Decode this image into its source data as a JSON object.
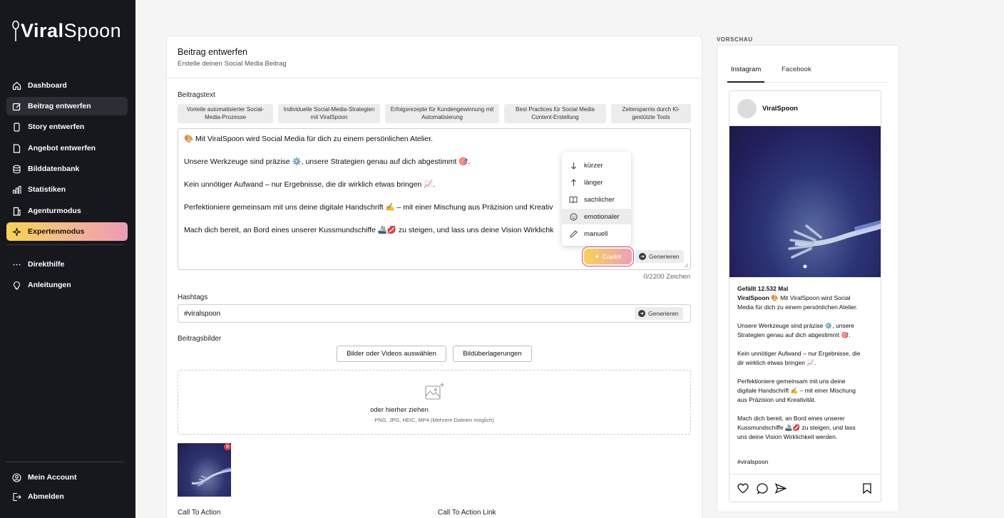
{
  "sidebar": {
    "logo_left": "Viral",
    "logo_right": "Spoon",
    "items": [
      {
        "label": "Dashboard",
        "icon": "home-icon"
      },
      {
        "label": "Beitrag entwerfen",
        "icon": "edit-icon"
      },
      {
        "label": "Story entwerfen",
        "icon": "phone-icon"
      },
      {
        "label": "Angebot entwerfen",
        "icon": "document-icon"
      },
      {
        "label": "Bilddatenbank",
        "icon": "database-icon"
      },
      {
        "label": "Statistiken",
        "icon": "bar-chart-icon"
      },
      {
        "label": "Agenturmodus",
        "icon": "building-icon"
      },
      {
        "label": "Expertenmodus",
        "icon": "sparkle-icon"
      }
    ],
    "secondary": [
      {
        "label": "Direkthilfe",
        "icon": "dots-icon"
      },
      {
        "label": "Anleitungen",
        "icon": "lightbulb-icon"
      }
    ],
    "account": [
      {
        "label": "Mein Account",
        "icon": "user-icon"
      },
      {
        "label": "Abmelden",
        "icon": "logout-icon"
      }
    ]
  },
  "editor": {
    "title": "Beitrag entwerfen",
    "subtitle": "Erstelle deinen Social Media Beitrag",
    "post_text_label": "Beitragstext",
    "suggestions": [
      "Vorteile automatisierter Social-Media-Prozesse",
      "Individuelle Social-Media-Strategien mit ViralSpoon",
      "Erfolgsrezepte für Kundengewinnung mit Automatisierung",
      "Best Practices für Social Media Content-Erstellung",
      "Zeitersparnis durch KI-gestützte Tools"
    ],
    "post_lines": [
      "🎨 Mit ViralSpoon wird Social Media für dich zu einem persönlichen Atelier.",
      "Unsere Werkzeuge sind präzise ⚙️, unsere Strategien genau auf dich abgestimmt 🎯.",
      "Kein unnötiger Aufwand – nur Ergebnisse, die dir wirklich etwas bringen 📈.",
      "Perfektioniere gemeinsam mit uns deine digitale Handschrift ✍️ – mit einer Mischung aus Präzision und Kreativ",
      "Mach dich bereit, an Bord eines unserer Kussmundschiffe 🚢💋 zu steigen, und lass uns deine Vision Wirklichk"
    ],
    "copilot_menu": [
      "kürzer",
      "länger",
      "sachlicher",
      "emotionaler",
      "manuell"
    ],
    "copilot_label": "Copilot",
    "generate_label": "Generieren",
    "char_counter": "0/2200 Zeichen",
    "hashtags_label": "Hashtags",
    "hashtags_value": "#viralspoon",
    "images_label": "Beitragsbilder",
    "select_media_label": "Bilder oder Videos auswählen",
    "overlays_label": "Bildüberlagerungen",
    "drop_text": "oder hierher ziehen",
    "drop_hint": "PNG, JPG, HEIC, MP4 (Mehrere Dateien möglich)",
    "cta_label": "Call To Action",
    "cta_link_label": "Call To Action Link"
  },
  "preview": {
    "label": "VORSCHAU",
    "tabs": [
      "Instagram",
      "Facebook"
    ],
    "username": "ViralSpoon",
    "likes": "Gefällt 12.532 Mal",
    "caption_lines": [
      "Mit ViralSpoon wird Social",
      "Media für dich zu einem persönlichen Atelier.",
      "",
      "Unsere Werkzeuge sind präzise ⚙️, unsere",
      "Strategien genau auf dich abgestimmt 🎯.",
      "",
      "Kein unnötiger Aufwand – nur Ergebnisse, die",
      "dir wirklich etwas bringen 📈.",
      "",
      "Perfektioniere gemeinsam mit uns deine",
      "digitale Handschrift ✍️ – mit einer Mischung",
      "aus Präzision und Kreativität.",
      "",
      "Mach dich bereit, an Bord eines unserer",
      "Kussmundschiffe 🚢💋 zu steigen, und lass",
      "uns deine Vision Wirklichkeit werden."
    ],
    "caption_emoji": "🎨",
    "hashtag": "#viralspoon"
  },
  "colors": {
    "sidebar_bg": "#16181d",
    "expert_gradient_start": "#f7d354",
    "expert_gradient_end": "#ee9bb5",
    "copilot_ring": "#d9506e"
  }
}
